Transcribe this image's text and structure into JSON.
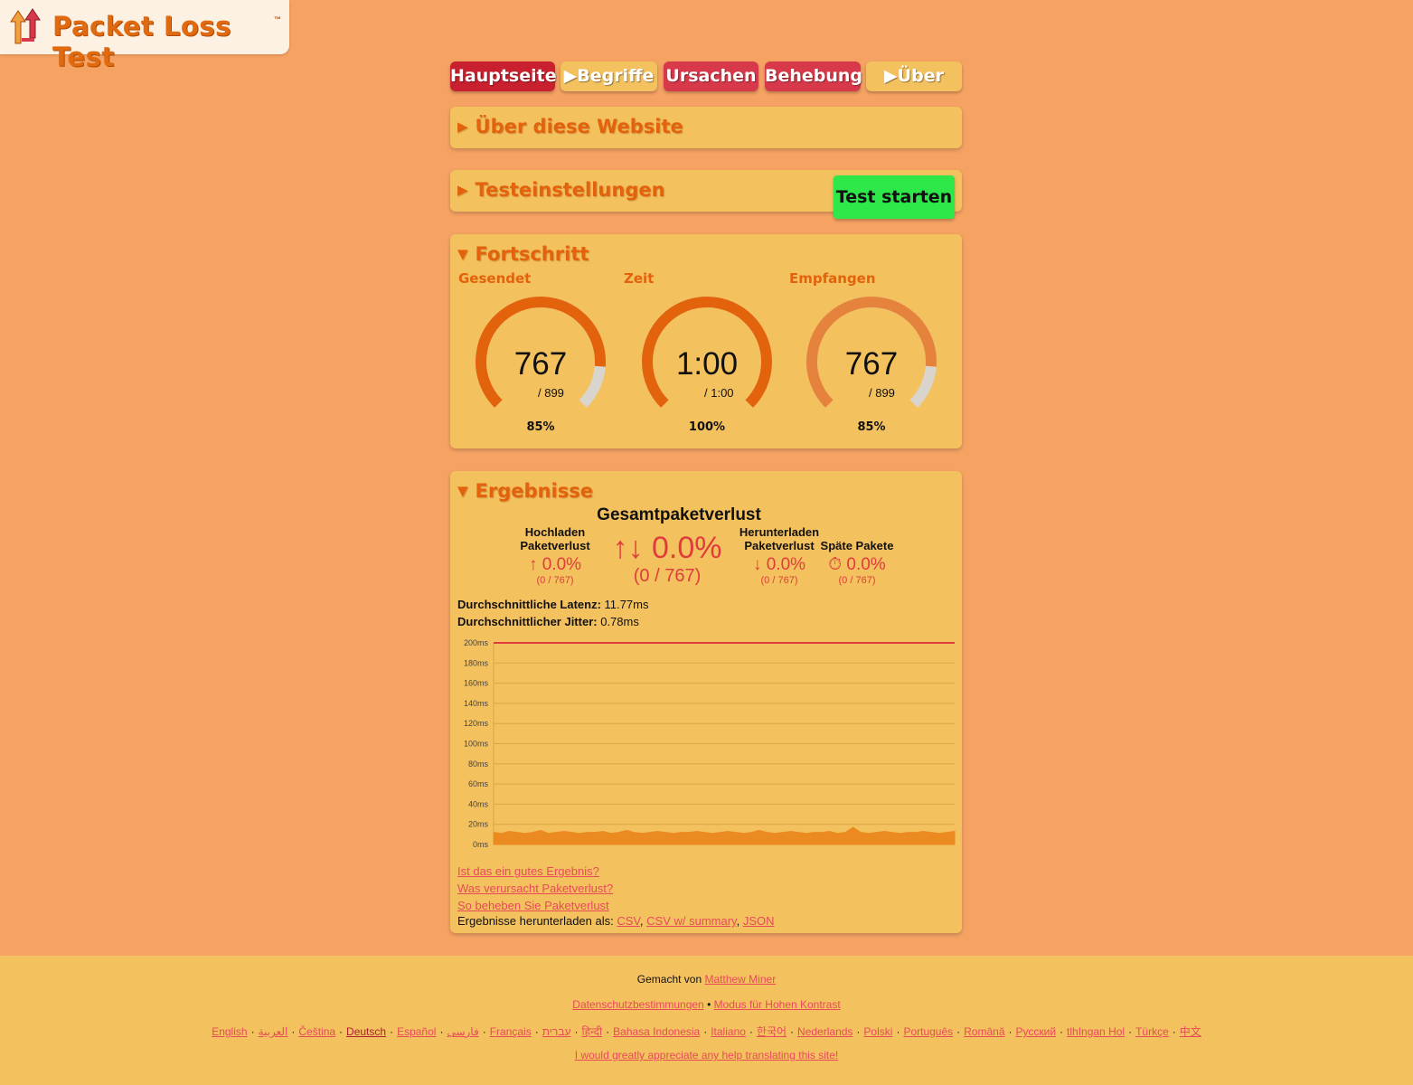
{
  "logo": {
    "text": "Packet Loss Test",
    "tm": "™"
  },
  "nav": {
    "home": "Hauptseite",
    "terms": "▶Begriffe",
    "causes": "Ursachen",
    "fix": "Behebung",
    "about": "▶Über"
  },
  "panels": {
    "about_title": "Über diese Website",
    "settings_title": "Testeinstellungen",
    "start_button": "Test starten",
    "progress_title": "Fortschritt",
    "results_title": "Ergebnisse"
  },
  "progress": {
    "sent": {
      "label": "Gesendet",
      "value": "767",
      "total": "/ 899",
      "percent": "85%",
      "fraction": 0.85
    },
    "time": {
      "label": "Zeit",
      "value": "1:00",
      "total": "/ 1:00",
      "percent": "100%",
      "fraction": 1.0
    },
    "received": {
      "label": "Empfangen",
      "value": "767",
      "total": "/ 899",
      "percent": "85%",
      "fraction": 0.85
    }
  },
  "results": {
    "total_title": "Gesamtpaketverlust",
    "total_value": "↑↓ 0.0%",
    "total_sub": "(0 / 767)",
    "upload_label_1": "Hochladen",
    "upload_label_2": "Paketverlust",
    "upload_value": "↑ 0.0%",
    "upload_sub": "(0 / 767)",
    "download_label_1": "Herunterladen",
    "download_label_2": "Paketverlust",
    "download_value": "↓ 0.0%",
    "download_sub": "(0 / 767)",
    "late_label": "Späte Pakete",
    "late_value": "⏱ 0.0%",
    "late_sub": "(0 / 767)",
    "latency_label": "Durchschnittliche Latenz:",
    "latency_value": "11.77ms",
    "jitter_label": "Durchschnittlicher Jitter:",
    "jitter_value": "0.78ms",
    "link_good": "Ist das ein gutes Ergebnis?",
    "link_cause": "Was verursacht Paketverlust?",
    "link_fix": "So beheben Sie Paketverlust",
    "download_text": "Ergebnisse herunterladen als:",
    "dl_csv": "CSV",
    "dl_csv_summary": "CSV w/ summary",
    "dl_json": "JSON",
    "comma": ","
  },
  "chart_data": {
    "type": "area",
    "title": "",
    "xlabel": "",
    "ylabel": "",
    "ylim": [
      0,
      200
    ],
    "yticks": [
      "0ms",
      "20ms",
      "40ms",
      "60ms",
      "80ms",
      "100ms",
      "120ms",
      "140ms",
      "160ms",
      "180ms",
      "200ms"
    ],
    "threshold_line": 200,
    "series": [
      {
        "values": [
          12,
          11,
          13,
          12,
          11,
          12,
          14,
          11,
          12,
          13,
          12,
          11,
          12,
          12,
          13,
          11,
          12,
          14,
          12,
          11,
          12,
          13,
          12,
          11,
          12,
          12,
          13,
          12,
          11,
          12,
          13,
          12,
          11,
          12,
          14,
          12,
          11,
          12,
          13,
          12,
          11,
          12,
          12,
          13,
          11,
          12,
          17,
          12,
          11,
          12,
          13,
          12,
          11,
          12,
          12,
          13,
          12,
          11,
          12,
          13
        ]
      }
    ],
    "colors": {
      "latency": "#ec8a22",
      "threshold": "#e03c3c"
    }
  },
  "footer": {
    "made_by": "Gemacht von",
    "author": "Matthew Miner",
    "privacy": "Datenschutzbestimmungen",
    "bullet": "•",
    "contrast": "Modus für Hohen Kontrast",
    "languages": [
      "English",
      "العربية",
      "Čeština",
      "Deutsch",
      "Español",
      "فارسی",
      "Français",
      "עברית",
      "हिन्दी",
      "Bahasa Indonesia",
      "Italiano",
      "한국어",
      "Nederlands",
      "Polski",
      "Português",
      "Română",
      "Русский",
      "tlhIngan Hol",
      "Türkçe",
      "中文"
    ],
    "dot": "·",
    "translate": "I would greatly appreciate any help translating this site!"
  },
  "colors": {
    "background": "#f5a263",
    "panel": "#f4c15f",
    "accent_orange": "#e3620c",
    "nav_red": "#d8394a",
    "start_green": "#2ee84a",
    "link": "#e84a5a"
  }
}
